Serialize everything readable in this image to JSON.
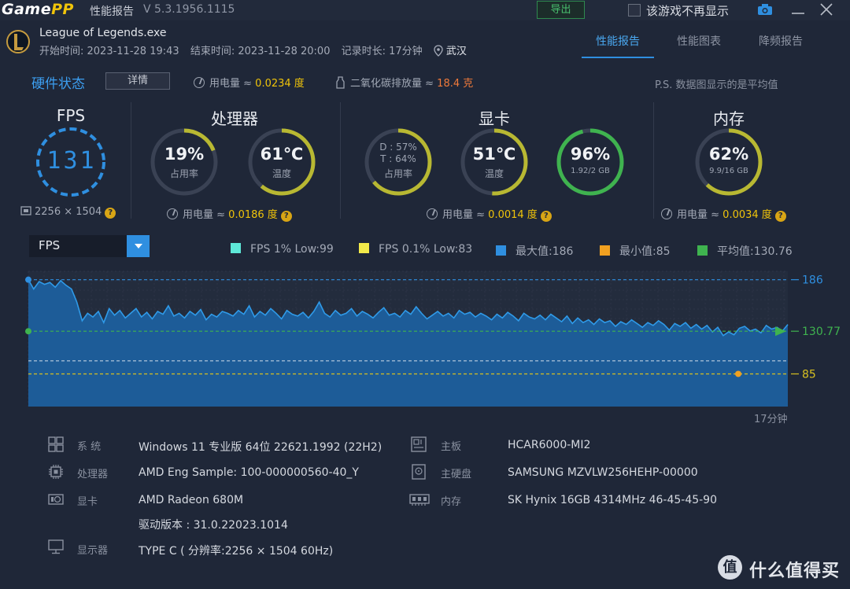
{
  "app": {
    "logo_part1": "Game",
    "logo_part2": "PP",
    "title": "性能报告",
    "version": "V 5.3.1956.1115",
    "export_label": "导出",
    "hide_label": "该游戏不再显示"
  },
  "game": {
    "name": "League of Legends.exe",
    "start": "开始时间: 2023-11-28 19:43",
    "end": "结束时间: 2023-11-28 20:00",
    "duration": "记录时长: 17分钟",
    "city": "武汉"
  },
  "tabs": [
    "性能报告",
    "性能图表",
    "降频报告"
  ],
  "status": {
    "title": "硬件状态",
    "detail_label": "详情",
    "power_label": "用电量 ≈ ",
    "power_value": "0.0234 度",
    "co2_label": "二氧化碳排放量 ≈ ",
    "co2_value": "18.4 克",
    "note": "P.S. 数据图显示的是平均值"
  },
  "sections": {
    "fps": "FPS",
    "cpu": "处理器",
    "gpu": "显卡",
    "mem": "内存"
  },
  "fps": {
    "value": "131",
    "resolution": "2256 × 1504"
  },
  "cpu": {
    "usage": "19%",
    "usage_label": "占用率",
    "usage_frac": 0.19,
    "temp": "61℃",
    "temp_label": "温度",
    "temp_frac": 0.61,
    "power_label": "用电量 ≈ ",
    "power_value": "0.0186 度"
  },
  "gpu": {
    "d": "D : 57%",
    "t": "T : 64%",
    "usage_label": "占用率",
    "usage_frac": 0.64,
    "temp": "51℃",
    "temp_label": "温度",
    "temp_frac": 0.51,
    "vram": "96%",
    "vram_detail": "1.92/2 GB",
    "vram_frac": 0.96,
    "power_label": "用电量 ≈ ",
    "power_value": "0.0014 度"
  },
  "mem": {
    "usage": "62%",
    "detail": "9.9/16 GB",
    "usage_frac": 0.62,
    "power_label": "用电量 ≈ ",
    "power_value": "0.0034 度"
  },
  "chart_controls": {
    "selector": "FPS"
  },
  "legend": [
    {
      "label": "FPS 1% Low:99",
      "color": "#5ee8d8"
    },
    {
      "label": "FPS 0.1% Low:83",
      "color": "#f2ea4a"
    },
    {
      "label": "最大值:186",
      "color": "#2f8fe0"
    },
    {
      "label": "最小值:85",
      "color": "#f0a020"
    },
    {
      "label": "平均值:130.76",
      "color": "#3fb34f"
    }
  ],
  "chart_data": {
    "type": "area",
    "title": "",
    "xlabel": "17分钟",
    "ylabel": "",
    "ylim": [
      50,
      195
    ],
    "ref_lines": [
      {
        "label": "186",
        "value": 186,
        "color": "#2f8fe0"
      },
      {
        "label": "130.77",
        "value": 130.77,
        "color": "#3fb34f"
      },
      {
        "label": "85",
        "value": 85,
        "color": "#d8c020"
      }
    ],
    "one_percent_low": 99,
    "point_0_1_percent_low": 83,
    "series": [
      {
        "values": [
          186,
          176,
          184,
          181,
          183,
          178,
          185,
          180,
          176,
          162,
          142,
          150,
          146,
          152,
          140,
          155,
          148,
          153,
          145,
          150,
          155,
          146,
          151,
          144,
          152,
          149,
          158,
          147,
          150,
          145,
          152,
          148,
          154,
          143,
          149,
          146,
          152,
          150,
          147,
          153,
          149,
          158,
          146,
          152,
          148,
          155,
          150,
          144,
          153,
          149,
          147,
          151,
          145,
          152,
          162,
          150,
          146,
          153,
          148,
          150,
          155,
          147,
          152,
          149,
          145,
          151,
          156,
          148,
          150,
          146,
          153,
          149,
          157,
          150,
          144,
          148,
          152,
          147,
          150,
          145,
          153,
          149,
          151,
          146,
          150,
          147,
          143,
          149,
          145,
          151,
          147,
          142,
          150,
          146,
          144,
          148,
          143,
          149,
          145,
          141,
          147,
          139,
          145,
          140,
          143,
          138,
          144,
          140,
          142,
          136,
          141,
          138,
          143,
          139,
          135,
          140,
          137,
          142,
          138,
          132,
          139,
          136,
          140,
          134,
          138,
          133,
          137,
          130,
          135,
          126,
          130,
          127,
          134,
          136,
          131,
          133,
          129,
          137,
          133,
          135,
          131,
          138
        ]
      }
    ]
  },
  "system": [
    {
      "label": "系  统",
      "value": "Windows 11 专业版 64位 22621.1992 (22H2)"
    },
    {
      "label": "处理器",
      "value": "AMD Eng Sample: 100-000000560-40_Y"
    },
    {
      "label": "显卡",
      "value": "AMD Radeon 680M"
    },
    {
      "label": "",
      "value": "驱动版本 : 31.0.22023.1014"
    },
    {
      "label": "显示器",
      "value": "TYPE C ( 分辨率:2256 × 1504 60Hz)"
    },
    {
      "label": "主板",
      "value": "HCAR6000-MI2"
    },
    {
      "label": "主硬盘",
      "value": "SAMSUNG MZVLW256HEHP-00000"
    },
    {
      "label": "内存",
      "value": "SK Hynix 16GB 4314MHz 46-45-45-90"
    }
  ],
  "watermark": {
    "icon_text": "值",
    "text": "什么值得买"
  }
}
